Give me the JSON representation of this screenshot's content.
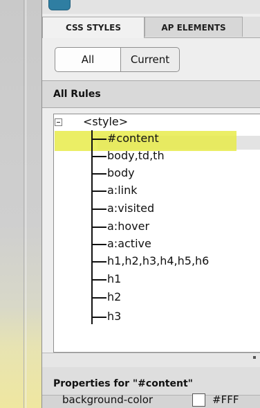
{
  "tabs": [
    {
      "label": "CSS STYLES"
    },
    {
      "label": "AP ELEMENTS"
    }
  ],
  "toggle": {
    "all_label": "All",
    "current_label": "Current"
  },
  "rules": {
    "header": "All Rules",
    "root": "<style>",
    "items": [
      {
        "label": "#content"
      },
      {
        "label": "body,td,th"
      },
      {
        "label": "body"
      },
      {
        "label": "a:link"
      },
      {
        "label": "a:visited"
      },
      {
        "label": "a:hover"
      },
      {
        "label": "a:active"
      },
      {
        "label": "h1,h2,h3,h4,h5,h6"
      },
      {
        "label": "h1"
      },
      {
        "label": "h2"
      },
      {
        "label": "h3"
      }
    ]
  },
  "properties": {
    "header": "Properties for \"#content\"",
    "rows": [
      {
        "name": "background-color",
        "value": "#FFF",
        "swatch_color": "#ffffff"
      }
    ]
  },
  "colors": {
    "highlight": "#e8eb4a",
    "icon_accent": "#2f7ea2"
  }
}
